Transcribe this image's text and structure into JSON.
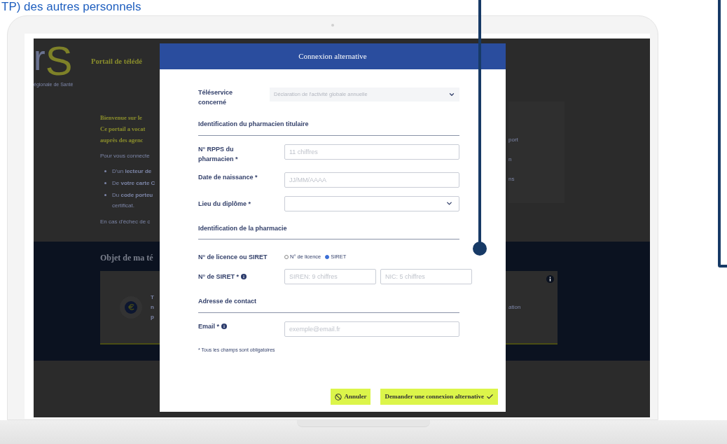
{
  "heading": "TP) des autres personnels",
  "background_page": {
    "logo": {
      "letter": "r",
      "accent": "S",
      "caption": "égionale de Santé"
    },
    "title": "Portail de télédé",
    "welcome_lines": [
      "Bienvenue sur le",
      "Ce portail a vocat",
      "auprès des agenc"
    ],
    "intro": "Pour vous connecte",
    "bullets": [
      {
        "lines": [
          "D'un **lecteur de**"
        ]
      },
      {
        "lines": [
          "De **votre carte C**"
        ]
      },
      {
        "lines": [
          "Du **code porteu**",
          "certificat."
        ]
      }
    ],
    "fallback": "En cas d'échec de c",
    "side_card_lines": [
      "port",
      "n",
      "ns"
    ],
    "section_title": "Objet de ma té",
    "card_lines": [
      "T",
      "n",
      "p"
    ],
    "card_right_lines": [
      "ation"
    ]
  },
  "modal": {
    "title": "Connexion alternative",
    "form": [
      {
        "kind": "select",
        "label": "Téléservice\nconcerné",
        "value": "Déclaration de l'activité globale annuelle",
        "disabled": true
      },
      {
        "kind": "section",
        "title": "Identification du pharmacien titulaire"
      },
      {
        "kind": "input",
        "label": "N° RPPS du\npharmacien *",
        "placeholder": "11 chiffres",
        "info": false
      },
      {
        "kind": "input",
        "label": "Date de naissance *",
        "placeholder": "JJ/MM/AAAA",
        "info": false
      },
      {
        "kind": "dropdown",
        "label": "Lieu du diplôme *"
      },
      {
        "kind": "section",
        "title": "Identification de la pharmacie"
      },
      {
        "kind": "radio",
        "label": "N° de licence ou SIRET",
        "options": [
          {
            "label": "N° de licence",
            "selected": false
          },
          {
            "label": "SIRET",
            "selected": true
          }
        ]
      },
      {
        "kind": "split",
        "label": "N° de SIRET *",
        "info": true,
        "fields": [
          {
            "placeholder": "SIREN: 9 chiffres"
          },
          {
            "placeholder": "NIC: 5 chiffres"
          }
        ]
      },
      {
        "kind": "section",
        "title": "Adresse de contact"
      },
      {
        "kind": "input",
        "label": "Email *",
        "placeholder": "exemple@email.fr",
        "info": true
      }
    ],
    "note": "* Tous les champs sont obligatoires",
    "buttons": [
      {
        "kind": "cancel",
        "label": "Annuler"
      },
      {
        "kind": "confirm",
        "label": "Demander une connexion alternative"
      }
    ]
  }
}
